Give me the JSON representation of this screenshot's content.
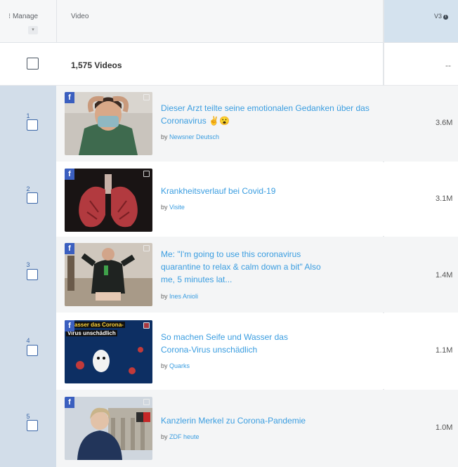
{
  "header": {
    "manage_label": "Manage",
    "video_label": "Video",
    "v3_label": "V3"
  },
  "summary": {
    "count_label": "1,575 Videos",
    "v3_value": "--"
  },
  "by_prefix": "by",
  "rows": [
    {
      "rank": "1",
      "title": "Dieser Arzt teilte seine emotionalen Gedanken über das Coronavirus ✌️😮",
      "channel": "Newsner Deutsch",
      "views": "3.6M"
    },
    {
      "rank": "2",
      "title": "Krankheitsverlauf bei Covid-19",
      "channel": "Visite",
      "views": "3.1M"
    },
    {
      "rank": "3",
      "title": "Me: \"I'm going to use this coronavirus quarantine to relax & calm down a bit\" Also me, 5 minutes lat...",
      "channel": "Ines Anioli",
      "views": "1.4M"
    },
    {
      "rank": "4",
      "title": "So machen Seife und Wasser das Corona-Virus unschädlich",
      "channel": "Quarks",
      "views": "1.1M",
      "thumb_caption_1": "asser das Corona-",
      "thumb_caption_2": "Virus unschädlich"
    },
    {
      "rank": "5",
      "title": "Kanzlerin Merkel zu Corona-Pandemie",
      "channel": "ZDF heute",
      "views": "1.0M"
    }
  ],
  "icons": {
    "platform": "facebook-icon",
    "external": "external-link-icon"
  },
  "colors": {
    "link": "#3a9de0",
    "rank_column": "#d2dde9",
    "facebook": "#3b5fbf",
    "header_highlight": "#d4e2ee"
  }
}
